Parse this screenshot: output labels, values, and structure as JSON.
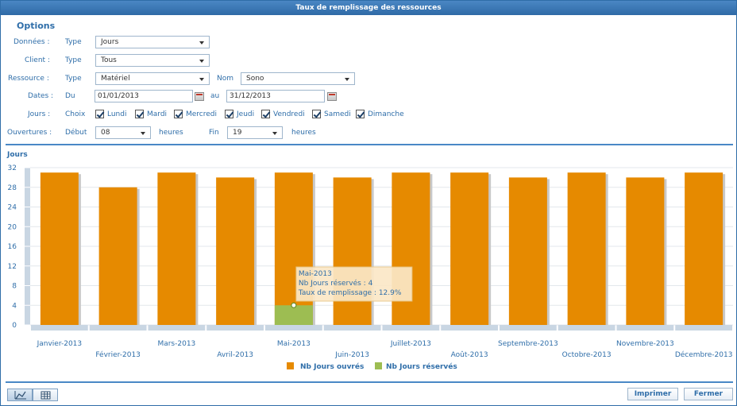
{
  "window": {
    "title": "Taux de remplissage des ressources"
  },
  "options": {
    "title": "Options",
    "donnees": {
      "label": "Données  :",
      "type_label": "Type",
      "value": "Jours"
    },
    "client": {
      "label": "Client  :",
      "type_label": "Type",
      "value": "Tous"
    },
    "ressource": {
      "label": "Ressource  :",
      "type_label": "Type",
      "value": "Matériel",
      "nom_label": "Nom",
      "nom_value": "Sono"
    },
    "dates": {
      "label": "Dates  :",
      "du_label": "Du",
      "du_value": "01/01/2013",
      "au_label": "au",
      "au_value": "31/12/2013"
    },
    "jours": {
      "label": "Jours  :",
      "choix_label": "Choix",
      "days": [
        "Lundi",
        "Mardi",
        "Mercredi",
        "Jeudi",
        "Vendredi",
        "Samedi",
        "Dimanche"
      ],
      "checked": [
        true,
        true,
        true,
        true,
        true,
        true,
        true
      ]
    },
    "ouvertures": {
      "label": "Ouvertures  :",
      "debut_label": "Début",
      "debut_value": "08",
      "heures1": "heures",
      "fin_label": "Fin",
      "fin_value": "19",
      "heures2": "heures"
    }
  },
  "chart_data": {
    "type": "bar",
    "ylabel": "Jours",
    "ylim": [
      0,
      32
    ],
    "yticks": [
      0,
      4,
      8,
      12,
      16,
      20,
      24,
      28,
      32
    ],
    "categories": [
      "Janvier-2013",
      "Février-2013",
      "Mars-2013",
      "Avril-2013",
      "Mai-2013",
      "Juin-2013",
      "Juillet-2013",
      "Août-2013",
      "Septembre-2013",
      "Octobre-2013",
      "Novembre-2013",
      "Décembre-2013"
    ],
    "series": [
      {
        "name": "Nb Jours ouvrés",
        "color": "#e68a00",
        "values": [
          31,
          28,
          31,
          30,
          31,
          30,
          31,
          31,
          30,
          31,
          30,
          31
        ]
      },
      {
        "name": "Nb Jours réservés",
        "color": "#9dbd52",
        "values": [
          0,
          0,
          0,
          0,
          4,
          0,
          0,
          0,
          0,
          0,
          0,
          0
        ]
      }
    ],
    "legend_position": "bottom",
    "grid": true,
    "tooltip": {
      "lines": [
        "Mai-2013",
        "Nb Jours réservés : 4",
        "Taux de remplissage : 12.9%"
      ]
    }
  },
  "footer": {
    "print_label": "Imprimer",
    "close_label": "Fermer"
  },
  "colors": {
    "accent": "#2f6ea9",
    "ouvres": "#e68a00",
    "reserves": "#9dbd52"
  }
}
